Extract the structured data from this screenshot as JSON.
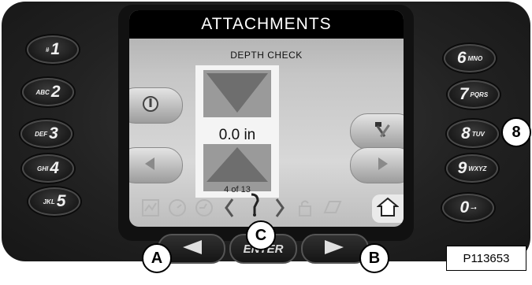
{
  "screen": {
    "title": "ATTACHMENTS",
    "subtitle": "DEPTH CHECK",
    "value": "0.0 in",
    "page": "4 of 13"
  },
  "keypad_left": [
    {
      "small": "#",
      "big": "1"
    },
    {
      "small": "ABC",
      "big": "2"
    },
    {
      "small": "DEF",
      "big": "3"
    },
    {
      "small": "GHI",
      "big": "4"
    },
    {
      "small": "JKL",
      "big": "5"
    }
  ],
  "keypad_right": [
    {
      "big": "6",
      "small": "MNO"
    },
    {
      "big": "7",
      "small": "PQRS"
    },
    {
      "big": "8",
      "small": "TUV"
    },
    {
      "big": "9",
      "small": "WXYZ"
    },
    {
      "big": "0",
      "small": "–•"
    }
  ],
  "nav": {
    "enter_label": "ENTER"
  },
  "callouts": {
    "a": "A",
    "b": "B",
    "c": "C",
    "eight": "8"
  },
  "figure_id": "P113653",
  "icons": [
    "power-icon",
    "left-arrow-icon",
    "tools-icon",
    "right-arrow-icon",
    "gauge-icon",
    "dial-icon",
    "speed-icon",
    "lift-arm-icon",
    "lock-icon",
    "notebook-icon",
    "home-icon"
  ],
  "colors": {
    "screen_bg": "#c8c8c8",
    "title_bar": "#000000",
    "device": "#1e1e1e"
  }
}
